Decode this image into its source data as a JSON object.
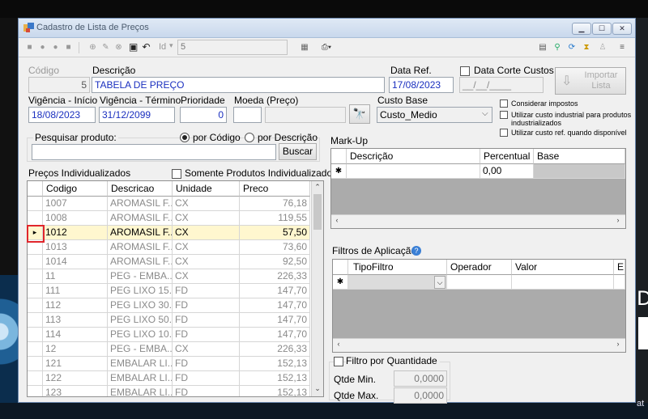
{
  "window": {
    "title": "Cadastro de Lista de Preços",
    "min": "▁",
    "max": "☐",
    "close": "✕"
  },
  "toolbar": {
    "id_label": "Id",
    "id_value": "5"
  },
  "form": {
    "codigo_label": "Código",
    "codigo_value": "5",
    "descricao_label": "Descrição",
    "descricao_value": "TABELA DE PREÇO",
    "data_ref_label": "Data Ref.",
    "data_ref_value": "17/08/2023",
    "data_corte_label": "Data Corte Custos",
    "data_corte_value": "__/__/____",
    "importar_label": "Importar\nLista",
    "vig_inicio_label": "Vigência - Início",
    "vig_inicio_value": "18/08/2023",
    "vig_termino_label": "Vigência - Término",
    "vig_termino_value": "31/12/2099",
    "prioridade_label": "Prioridade",
    "prioridade_value": "0",
    "moeda_label": "Moeda (Preço)",
    "moeda_code": "",
    "moeda_desc": "",
    "custo_base_label": "Custo Base",
    "custo_base_value": "Custo_Medio",
    "considerar_impostos": "Considerar impostos",
    "utilizar_industrial": "Utilizar custo industrial para produtos industrializados",
    "utilizar_ref": "Utilizar custo ref. quando disponível"
  },
  "search": {
    "label": "Pesquisar produto:",
    "por_codigo": "por Código",
    "por_descricao": "por Descrição",
    "value": "",
    "button": "Buscar"
  },
  "precos": {
    "title": "Preços Individualizados",
    "somente": "Somente Produtos Individualizados",
    "columns": [
      "Codigo",
      "Descricao",
      "Unidade",
      "Preco"
    ],
    "rows": [
      {
        "codigo": "1007",
        "descricao": "AROMASIL F...",
        "unidade": "CX",
        "preco": "76,18"
      },
      {
        "codigo": "1008",
        "descricao": "AROMASIL F...",
        "unidade": "CX",
        "preco": "119,55"
      },
      {
        "codigo": "1012",
        "descricao": "AROMASIL F...",
        "unidade": "CX",
        "preco": "57,50"
      },
      {
        "codigo": "1013",
        "descricao": "AROMASIL F...",
        "unidade": "CX",
        "preco": "73,60"
      },
      {
        "codigo": "1014",
        "descricao": "AROMASIL F...",
        "unidade": "CX",
        "preco": "92,50"
      },
      {
        "codigo": "11",
        "descricao": "PEG - EMBA...",
        "unidade": "CX",
        "preco": "226,33"
      },
      {
        "codigo": "111",
        "descricao": "PEG LIXO 15...",
        "unidade": "FD",
        "preco": "147,70"
      },
      {
        "codigo": "112",
        "descricao": "PEG LIXO 30...",
        "unidade": "FD",
        "preco": "147,70"
      },
      {
        "codigo": "113",
        "descricao": "PEG LIXO 50...",
        "unidade": "FD",
        "preco": "147,70"
      },
      {
        "codigo": "114",
        "descricao": "PEG LIXO 10...",
        "unidade": "FD",
        "preco": "147,70"
      },
      {
        "codigo": "12",
        "descricao": "PEG - EMBA...",
        "unidade": "CX",
        "preco": "226,33"
      },
      {
        "codigo": "121",
        "descricao": "EMBALAR LI...",
        "unidade": "FD",
        "preco": "152,13"
      },
      {
        "codigo": "122",
        "descricao": "EMBALAR LI...",
        "unidade": "FD",
        "preco": "152,13"
      },
      {
        "codigo": "123",
        "descricao": "EMBALAR LI...",
        "unidade": "FD",
        "preco": "152,13"
      }
    ]
  },
  "markup": {
    "title": "Mark-Up",
    "columns": [
      "Descrição",
      "Percentual",
      "Base"
    ],
    "new_row_percentual": "0,00"
  },
  "filtros": {
    "title": "Filtros de Aplicação",
    "columns": [
      "TipoFiltro",
      "Operador",
      "Valor",
      "E"
    ]
  },
  "quantidade": {
    "label": "Filtro por Quantidade",
    "min_label": "Qtde Min.",
    "min_value": "0,0000",
    "max_label": "Qtde Max.",
    "max_value": "0,0000"
  },
  "desktop": {
    "side_letter": "D",
    "bottom_text": "at"
  }
}
